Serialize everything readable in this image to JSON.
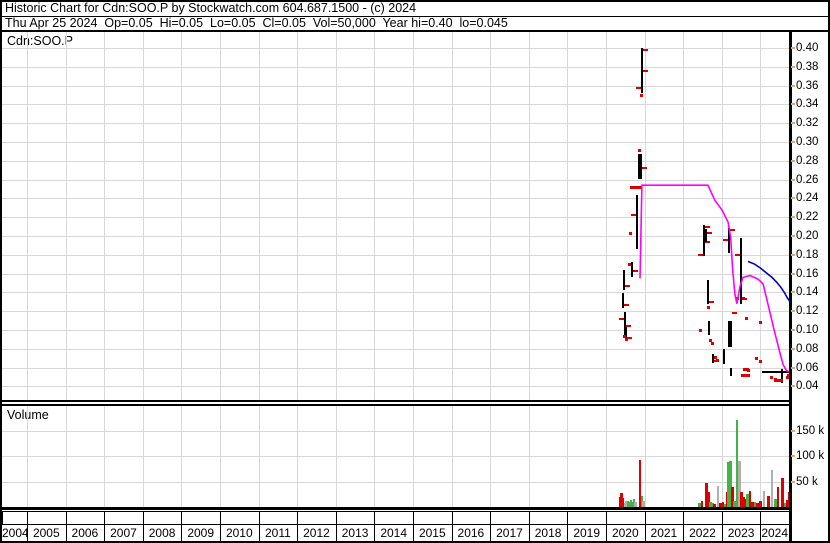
{
  "header": {
    "line1": "Historic Chart for Cdn:SOO.P by Stockwatch.com 604.687.1500 - (c) 2024",
    "line2": "Thu Apr 25 2024  Op=0.05  Hi=0.05  Lo=0.05  Cl=0.05  Vol=50,000  Year hi=0.40  lo=0.045"
  },
  "price_panel": {
    "label": "Cdn:SOO.P"
  },
  "volume_panel": {
    "label": "Volume"
  },
  "colors": {
    "grid": "#d8d8d8",
    "border": "#000000",
    "bar_black": "#000000",
    "tick_red": "#dd0000",
    "volume_red": "#dd0000",
    "volume_green": "#44b244",
    "volume_gray": "#b0b0b0",
    "pink_line": "#ff00ff",
    "blue_line": "#0000cc",
    "axis_tan_tick": "#d8aa70"
  },
  "chart_data": {
    "type": "ohlc",
    "symbol": "Cdn:SOO.P",
    "x_axis": {
      "year_labels": [
        "2004",
        "2005",
        "2006",
        "2007",
        "2008",
        "2009",
        "2010",
        "2011",
        "2012",
        "2013",
        "2014",
        "2015",
        "2016",
        "2017",
        "2018",
        "2019",
        "2020",
        "2021",
        "2022",
        "2023",
        "2024"
      ]
    },
    "price_axis": {
      "min": 0.04,
      "max": 0.4,
      "step": 0.02,
      "tick_labels": [
        "0.40",
        "0.38",
        "0.36",
        "0.34",
        "0.32",
        "0.30",
        "0.28",
        "0.26",
        "0.24",
        "0.22",
        "0.20",
        "0.18",
        "0.16",
        "0.14",
        "0.12",
        "0.10",
        "0.08",
        "0.06",
        "0.04"
      ]
    },
    "volume_axis": {
      "tick_labels": [
        "150 k",
        "100 k",
        "50 k"
      ],
      "tick_values_k": [
        150,
        100,
        50
      ]
    },
    "price_bars": [
      {
        "x": 2020.43,
        "hi": 0.139,
        "lo": 0.123,
        "ticks": [
          {
            "s": "r",
            "p": 0.127
          }
        ]
      },
      {
        "x": 2020.46,
        "hi": 0.164,
        "lo": 0.143,
        "ticks": [
          {
            "s": "r",
            "p": 0.147
          }
        ]
      },
      {
        "x": 2020.49,
        "hi": 0.119,
        "lo": 0.095,
        "ticks": [
          {
            "s": "l",
            "p": 0.112
          },
          {
            "s": "r",
            "p": 0.104
          }
        ]
      },
      {
        "x": 2020.53,
        "hi": 0.103,
        "lo": 0.088,
        "ticks": [
          {
            "s": "r",
            "p": 0.091
          }
        ]
      },
      {
        "x": 2020.67,
        "hi": 0.172,
        "lo": 0.156,
        "ticks": [
          {
            "s": "r",
            "p": 0.163
          }
        ]
      },
      {
        "x": 2020.8,
        "hi": 0.244,
        "lo": 0.186,
        "ticks": [
          {
            "s": "l",
            "p": 0.222
          }
        ]
      },
      {
        "x": 2020.87,
        "hi": 0.287,
        "lo": 0.261,
        "w": 4,
        "ticks": [
          {
            "s": "r",
            "p": 0.272
          }
        ]
      },
      {
        "x": 2020.92,
        "hi": 0.4,
        "lo": 0.352,
        "ticks": [
          {
            "s": "r",
            "p": 0.398
          },
          {
            "s": "r",
            "p": 0.376
          },
          {
            "s": "l",
            "p": 0.357
          }
        ]
      },
      {
        "x": 2022.53,
        "hi": 0.212,
        "lo": 0.179,
        "ticks": [
          {
            "s": "r",
            "p": 0.21
          },
          {
            "s": "r",
            "p": 0.194
          },
          {
            "s": "l",
            "p": 0.18
          }
        ]
      },
      {
        "x": 2022.6,
        "hi": 0.207,
        "lo": 0.194,
        "ticks": [
          {
            "s": "r",
            "p": 0.203
          }
        ]
      },
      {
        "x": 2022.64,
        "hi": 0.153,
        "lo": 0.128,
        "ticks": [
          {
            "s": "r",
            "p": 0.13
          }
        ]
      },
      {
        "x": 2022.66,
        "hi": 0.11,
        "lo": 0.095,
        "ticks": []
      },
      {
        "x": 2022.76,
        "hi": 0.075,
        "lo": 0.065,
        "ticks": [
          {
            "s": "r",
            "p": 0.067
          }
        ]
      },
      {
        "x": 2023.06,
        "hi": 0.08,
        "lo": 0.064,
        "ticks": []
      },
      {
        "x": 2023.19,
        "hi": 0.209,
        "lo": 0.182,
        "ticks": [
          {
            "s": "r",
            "p": 0.206
          },
          {
            "s": "l",
            "p": 0.196
          }
        ]
      },
      {
        "x": 2023.21,
        "hi": 0.11,
        "lo": 0.082,
        "w": 4,
        "ticks": [
          {
            "s": "r",
            "p": 0.118
          }
        ]
      },
      {
        "x": 2023.23,
        "hi": 0.06,
        "lo": 0.051,
        "ticks": []
      },
      {
        "x": 2023.5,
        "hi": 0.198,
        "lo": 0.128,
        "ticks": [
          {
            "s": "l",
            "p": 0.18
          },
          {
            "s": "r",
            "p": 0.133
          }
        ]
      },
      {
        "x": 2024.56,
        "hi": 0.058,
        "lo": 0.044,
        "ticks": []
      }
    ],
    "price_marks": {
      "dots": [
        [
          2020.47,
          0.093
        ],
        [
          2020.53,
          0.09
        ],
        [
          2020.6,
          0.17
        ],
        [
          2020.63,
          0.203
        ],
        [
          2020.87,
          0.291
        ],
        [
          2020.92,
          0.349
        ],
        [
          2022.44,
          0.1
        ],
        [
          2022.66,
          0.124
        ],
        [
          2022.7,
          0.089
        ],
        [
          2022.75,
          0.086
        ],
        [
          2022.83,
          0.071
        ],
        [
          2022.88,
          0.068
        ],
        [
          2023.4,
          0.133
        ],
        [
          2023.55,
          0.133
        ],
        [
          2023.63,
          0.112
        ],
        [
          2023.91,
          0.07
        ],
        [
          2023.99,
          0.108
        ],
        [
          2023.99,
          0.067
        ],
        [
          2023.6,
          0.058
        ],
        [
          2023.66,
          0.058
        ],
        [
          2023.7,
          0.057
        ],
        [
          2024.3,
          0.049
        ],
        [
          2024.4,
          0.047
        ],
        [
          2024.52,
          0.046
        ],
        [
          2024.69,
          0.05
        ],
        [
          2024.74,
          0.052
        ]
      ],
      "dashes": [
        [
          2020.73,
          0.252
        ],
        [
          2020.8,
          0.252
        ],
        [
          2023.6,
          0.052
        ],
        [
          2024.45,
          0.046
        ]
      ],
      "hlines": [
        {
          "x1": 2024.04,
          "x2": 2024.76,
          "p": 0.055
        }
      ]
    },
    "overlay_lines": [
      {
        "name": "pink-trend-line",
        "color": "#ff00ff",
        "points": [
          [
            2020.88,
            0.155
          ],
          [
            2020.9,
            0.19
          ],
          [
            2020.93,
            0.254
          ],
          [
            2022.64,
            0.254
          ],
          [
            2022.82,
            0.238
          ],
          [
            2023.0,
            0.228
          ],
          [
            2023.16,
            0.215
          ],
          [
            2023.23,
            0.198
          ],
          [
            2023.28,
            0.165
          ],
          [
            2023.34,
            0.138
          ],
          [
            2023.39,
            0.128
          ],
          [
            2023.47,
            0.146
          ],
          [
            2023.55,
            0.156
          ],
          [
            2023.73,
            0.158
          ],
          [
            2023.94,
            0.154
          ],
          [
            2024.07,
            0.149
          ],
          [
            2024.25,
            0.118
          ],
          [
            2024.38,
            0.096
          ],
          [
            2024.51,
            0.075
          ],
          [
            2024.59,
            0.063
          ],
          [
            2024.67,
            0.057
          ],
          [
            2024.77,
            0.055
          ]
        ]
      },
      {
        "name": "blue-ma-line",
        "color": "#0000cc",
        "points": [
          [
            2023.68,
            0.173
          ],
          [
            2023.85,
            0.17
          ],
          [
            2024.0,
            0.166
          ],
          [
            2024.15,
            0.161
          ],
          [
            2024.3,
            0.156
          ],
          [
            2024.42,
            0.151
          ],
          [
            2024.52,
            0.146
          ],
          [
            2024.62,
            0.14
          ],
          [
            2024.7,
            0.134
          ],
          [
            2024.77,
            0.13
          ]
        ]
      }
    ],
    "volume_bars": [
      {
        "x": 2020.36,
        "k": 20,
        "c": "red"
      },
      {
        "x": 2020.4,
        "k": 28,
        "c": "red"
      },
      {
        "x": 2020.44,
        "k": 18,
        "c": "red"
      },
      {
        "x": 2020.48,
        "k": 8,
        "c": "gray"
      },
      {
        "x": 2020.52,
        "k": 12,
        "c": "gray"
      },
      {
        "x": 2020.56,
        "k": 12,
        "c": "green"
      },
      {
        "x": 2020.6,
        "k": 10,
        "c": "green"
      },
      {
        "x": 2020.64,
        "k": 14,
        "c": "green"
      },
      {
        "x": 2020.68,
        "k": 9,
        "c": "green"
      },
      {
        "x": 2020.72,
        "k": 16,
        "c": "green"
      },
      {
        "x": 2020.76,
        "k": 10,
        "c": "gray"
      },
      {
        "x": 2020.88,
        "k": 92,
        "c": "red"
      },
      {
        "x": 2020.93,
        "k": 22,
        "c": "green"
      },
      {
        "x": 2020.97,
        "k": 12,
        "c": "gray"
      },
      {
        "x": 2022.42,
        "k": 8,
        "c": "green"
      },
      {
        "x": 2022.48,
        "k": 12,
        "c": "red"
      },
      {
        "x": 2022.6,
        "k": 48,
        "c": "red"
      },
      {
        "x": 2022.65,
        "k": 30,
        "c": "red"
      },
      {
        "x": 2022.7,
        "k": 10,
        "c": "green"
      },
      {
        "x": 2022.75,
        "k": 8,
        "c": "green"
      },
      {
        "x": 2022.8,
        "k": 6,
        "c": "red"
      },
      {
        "x": 2022.89,
        "k": 42,
        "c": "gray"
      },
      {
        "x": 2022.96,
        "k": 8,
        "c": "red"
      },
      {
        "x": 2023.03,
        "k": 10,
        "c": "red"
      },
      {
        "x": 2023.08,
        "k": 6,
        "c": "green"
      },
      {
        "x": 2023.13,
        "k": 30,
        "c": "red"
      },
      {
        "x": 2023.17,
        "k": 88,
        "c": "green"
      },
      {
        "x": 2023.22,
        "k": 90,
        "c": "green"
      },
      {
        "x": 2023.27,
        "k": 40,
        "c": "red"
      },
      {
        "x": 2023.32,
        "k": 12,
        "c": "green"
      },
      {
        "x": 2023.39,
        "k": 170,
        "c": "green"
      },
      {
        "x": 2023.45,
        "k": 90,
        "c": "gray"
      },
      {
        "x": 2023.5,
        "k": 30,
        "c": "red"
      },
      {
        "x": 2023.55,
        "k": 20,
        "c": "red"
      },
      {
        "x": 2023.6,
        "k": 16,
        "c": "red"
      },
      {
        "x": 2023.66,
        "k": 25,
        "c": "green"
      },
      {
        "x": 2023.73,
        "k": 32,
        "c": "red"
      },
      {
        "x": 2023.79,
        "k": 10,
        "c": "red"
      },
      {
        "x": 2023.86,
        "k": 10,
        "c": "green"
      },
      {
        "x": 2023.92,
        "k": 8,
        "c": "red"
      },
      {
        "x": 2023.99,
        "k": 12,
        "c": "red"
      },
      {
        "x": 2024.09,
        "k": 32,
        "c": "gray"
      },
      {
        "x": 2024.2,
        "k": 22,
        "c": "red"
      },
      {
        "x": 2024.3,
        "k": 72,
        "c": "gray"
      },
      {
        "x": 2024.38,
        "k": 16,
        "c": "green"
      },
      {
        "x": 2024.45,
        "k": 40,
        "c": "red"
      },
      {
        "x": 2024.56,
        "k": 56,
        "c": "red"
      },
      {
        "x": 2024.63,
        "k": 8,
        "c": "green"
      },
      {
        "x": 2024.69,
        "k": 14,
        "c": "red"
      },
      {
        "x": 2024.75,
        "k": 30,
        "c": "red"
      }
    ]
  }
}
